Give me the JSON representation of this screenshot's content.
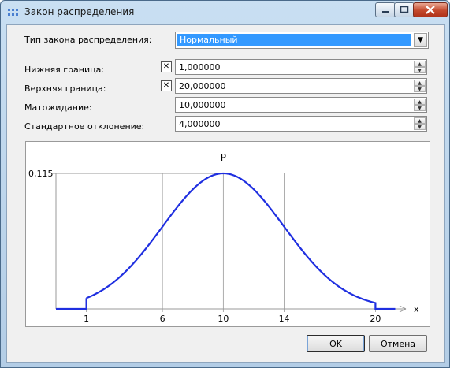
{
  "window": {
    "title": "Закон распределения"
  },
  "form": {
    "distribution_type_label": "Тип закона распределения:",
    "distribution_type_value": "Нормальный",
    "lower_bound_label": "Нижняя граница:",
    "lower_bound_value": "1,000000",
    "lower_bound_checked": true,
    "upper_bound_label": "Верхняя граница:",
    "upper_bound_value": "20,000000",
    "upper_bound_checked": true,
    "mean_label": "Матожидание:",
    "mean_value": "10,000000",
    "stddev_label": "Стандартное отклонение:",
    "stddev_value": "4,000000"
  },
  "chart_data": {
    "type": "line",
    "title": "P",
    "xlabel": "x",
    "ylabel": "",
    "peak_label": "0,115",
    "x_ticks": [
      "1",
      "6",
      "10",
      "14",
      "20"
    ],
    "mean": 10,
    "stddev": 4,
    "lower": 1,
    "upper": 20,
    "xlim": [
      -1,
      22
    ],
    "ylim": [
      0,
      0.115
    ],
    "line_color": "#1f2fe0",
    "grid_color": "#999999"
  },
  "buttons": {
    "ok": "OK",
    "cancel": "Отмена"
  }
}
